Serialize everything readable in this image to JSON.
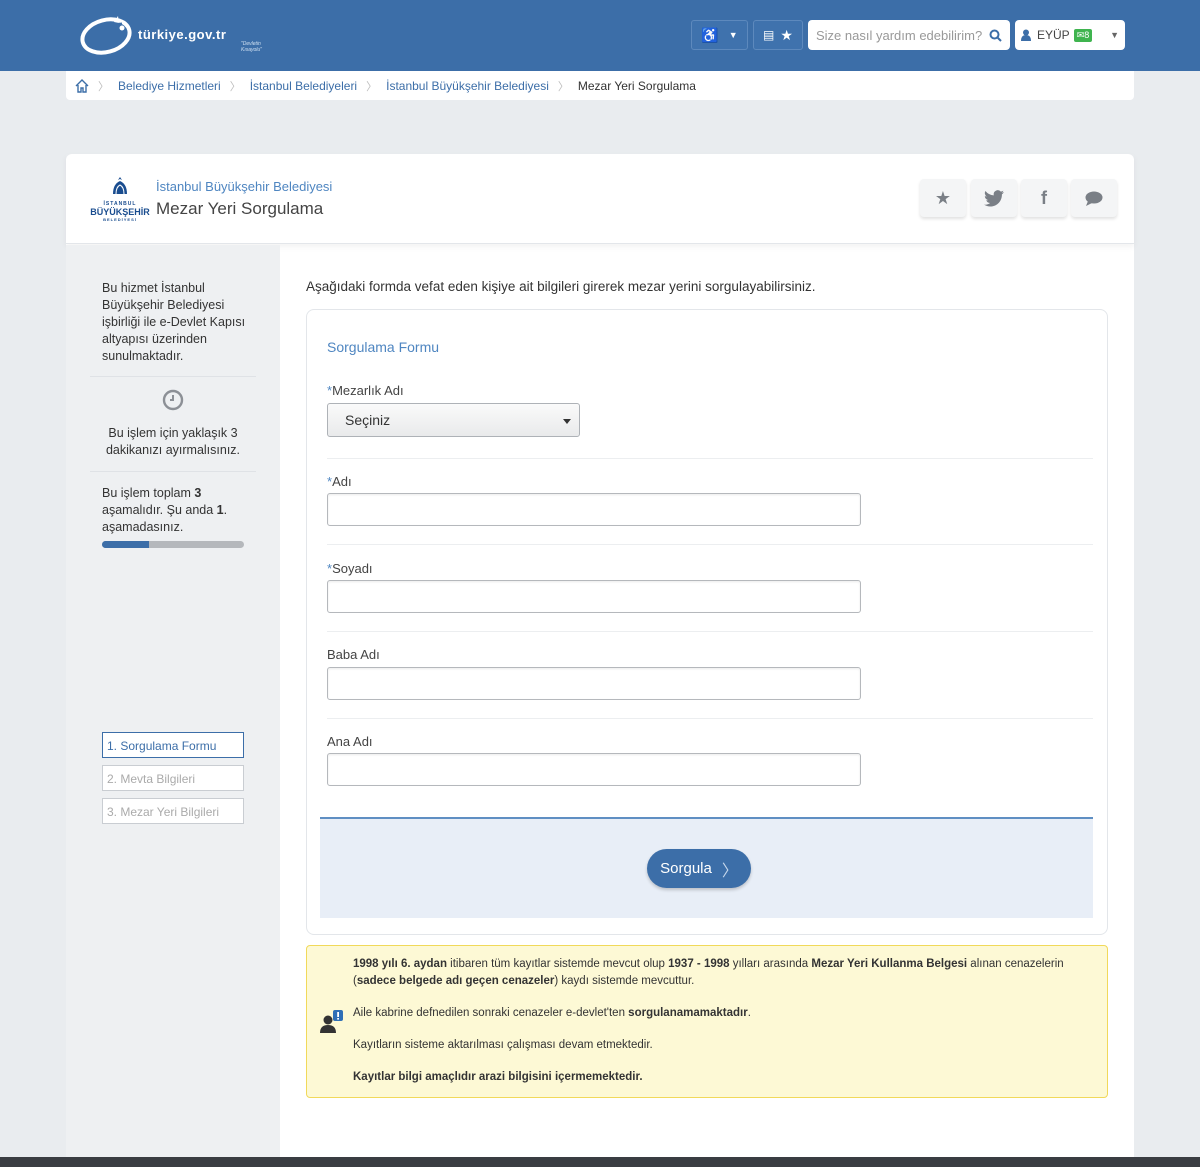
{
  "header": {
    "logo_text": "türkiye.gov.tr",
    "logo_subtext": "\"Devletin Kısayolu\"",
    "search_placeholder": "Size nasıl yardım edebilirim?",
    "user_name": "EYÜP",
    "message_count": "8",
    "colors": {
      "bar": "#3c6ea8",
      "badge": "#3fb44f"
    }
  },
  "breadcrumb": {
    "items": [
      "Belediye Hizmetleri",
      "İstanbul Belediyeleri",
      "İstanbul Büyükşehir Belediyesi",
      "Mezar Yeri Sorgulama"
    ]
  },
  "service": {
    "logo_small": "İSTANBUL",
    "logo_big": "BÜYÜKŞEHİR",
    "logo_bottom": "BELEDİYESİ",
    "organization": "İstanbul Büyükşehir Belediyesi",
    "title": "Mezar Yeri Sorgulama",
    "share_icons": [
      "star-icon",
      "twitter-icon",
      "facebook-icon",
      "comment-icon"
    ]
  },
  "sidebar": {
    "info": "Bu hizmet İstanbul Büyükşehir Belediyesi işbirliği ile e-Devlet Kapısı altyapısı üzerinden sunulmaktadır.",
    "time_line1": "Bu işlem için yaklaşık 3",
    "time_line2": "dakikanızı ayırmalısınız.",
    "stage_text_a": "Bu işlem toplam ",
    "stage_total": "3",
    "stage_text_b": " aşamalıdır. Şu anda ",
    "stage_current": "1",
    "stage_text_c": ". aşamadasınız.",
    "progress": 0.33,
    "steps": [
      "1. Sorgulama Formu",
      "2. Mevta Bilgileri",
      "3. Mezar Yeri Bilgileri"
    ]
  },
  "main": {
    "intro": "Aşağıdaki formda vefat eden kişiye ait bilgileri girerek mezar yerini sorgulayabilirsiniz.",
    "form_title": "Sorgulama Formu",
    "required_mark": "*",
    "fields": {
      "mezarlik_label": "Mezarlık Adı",
      "mezarlik_value": "Seçiniz",
      "adi_label": "Adı",
      "soyadi_label": "Soyadı",
      "baba_label": "Baba Adı",
      "ana_label": "Ana Adı"
    },
    "submit_label": "Sorgula"
  },
  "notice": {
    "p1_b1": "1998 yılı 6. aydan",
    "p1_t1": " itibaren tüm kayıtlar sistemde mevcut olup ",
    "p1_b2": "1937 - 1998",
    "p1_t2": " yılları arasında ",
    "p1_b3": "Mezar Yeri Kullanma Belgesi",
    "p1_t3": " alınan cenazelerin (",
    "p1_b4": "sadece belgede adı geçen cenazeler",
    "p1_t4": ") kaydı sistemde mevcuttur.",
    "p2_t1": "Aile kabrine defnedilen sonraki cenazeler e-devlet'ten ",
    "p2_b1": "sorgulanamamaktadır",
    "p2_t2": ".",
    "p3": "Kayıtların sisteme aktarılması çalışması devam etmektedir.",
    "p4": "Kayıtlar bilgi amaçlıdır arazi bilgisini içermemektedir."
  }
}
